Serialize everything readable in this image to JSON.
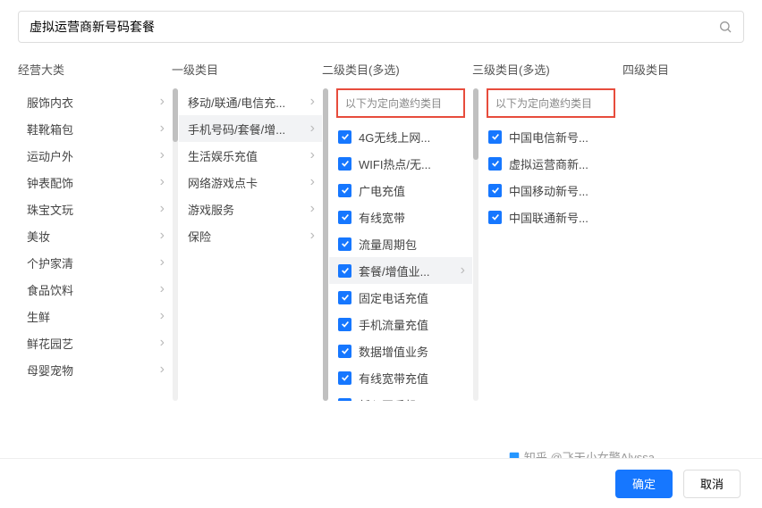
{
  "search": {
    "value": "虚拟运营商新号码套餐"
  },
  "headers": {
    "col0": "经营大类",
    "col1": "一级类目",
    "col2": "二级类目(多选)",
    "col3": "三级类目(多选)",
    "col4": "四级类目"
  },
  "invite_label": "以下为定向邀约类目",
  "col0": {
    "items": [
      "服饰内衣",
      "鞋靴箱包",
      "运动户外",
      "钟表配饰",
      "珠宝文玩",
      "美妆",
      "个护家清",
      "食品饮料",
      "生鲜",
      "鲜花园艺",
      "母婴宠物"
    ]
  },
  "col1": {
    "items": [
      {
        "label": "移动/联通/电信充...",
        "selected": false
      },
      {
        "label": "手机号码/套餐/增...",
        "selected": true
      },
      {
        "label": "生活娱乐充值",
        "selected": false
      },
      {
        "label": "网络游戏点卡",
        "selected": false
      },
      {
        "label": "游戏服务",
        "selected": false
      },
      {
        "label": "保险",
        "selected": false
      }
    ]
  },
  "col2": {
    "items": [
      {
        "label": "4G无线上网...",
        "selected": false
      },
      {
        "label": "WIFI热点/无...",
        "selected": false
      },
      {
        "label": "广电充值",
        "selected": false
      },
      {
        "label": "有线宽带",
        "selected": false
      },
      {
        "label": "流量周期包",
        "selected": false
      },
      {
        "label": "套餐/增值业...",
        "selected": true
      },
      {
        "label": "固定电话充值",
        "selected": false
      },
      {
        "label": "手机流量充值",
        "selected": false
      },
      {
        "label": "数据增值业务",
        "selected": false
      },
      {
        "label": "有线宽带充值",
        "selected": false
      },
      {
        "label": "新入网手机",
        "selected": false
      }
    ]
  },
  "col3": {
    "items": [
      {
        "label": "中国电信新号..."
      },
      {
        "label": "虚拟运营商新..."
      },
      {
        "label": "中国移动新号..."
      },
      {
        "label": "中国联通新号..."
      }
    ]
  },
  "footer": {
    "confirm": "确定",
    "cancel": "取消"
  },
  "watermark": "知乎 @飞天小女警Alyssa"
}
